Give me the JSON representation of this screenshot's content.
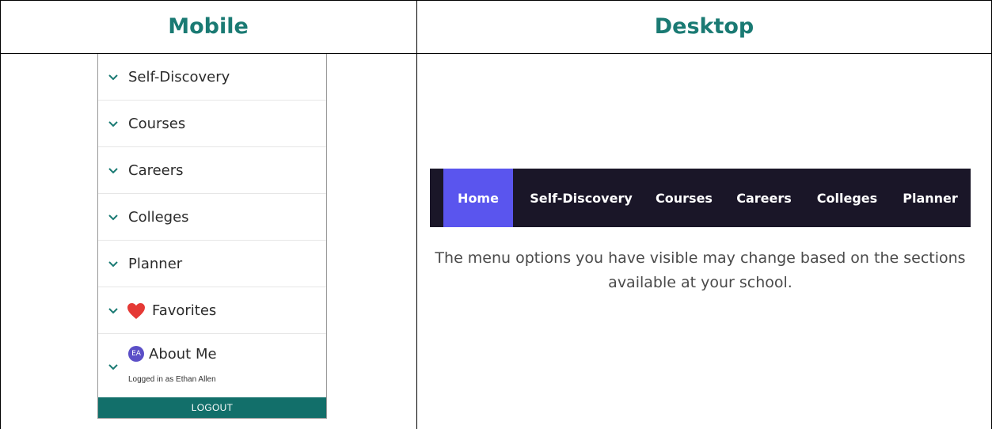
{
  "headers": {
    "mobile": "Mobile",
    "desktop": "Desktop"
  },
  "mobile_menu": {
    "items": [
      {
        "label": "Self-Discovery"
      },
      {
        "label": "Courses"
      },
      {
        "label": "Careers"
      },
      {
        "label": "Colleges"
      },
      {
        "label": "Planner"
      },
      {
        "label": "Favorites",
        "icon": "heart-icon"
      },
      {
        "label": "About Me",
        "icon": "avatar"
      }
    ],
    "avatar_initials": "EA",
    "logged_in_text": "Logged in as Ethan Allen",
    "logout_label": "LOGOUT"
  },
  "desktop_nav": {
    "items": [
      "Home",
      "Self-Discovery",
      "Courses",
      "Careers",
      "Colleges",
      "Planner"
    ],
    "active": "Home"
  },
  "description": "The menu options you have visible may change based on the sections available at your school.",
  "colors": {
    "header_text": "#1a7a73",
    "nav_bg": "#1a1628",
    "nav_active": "#5a55ee",
    "logout_bg": "#126f6a",
    "heart": "#e53935",
    "avatar": "#5b4fc7"
  }
}
